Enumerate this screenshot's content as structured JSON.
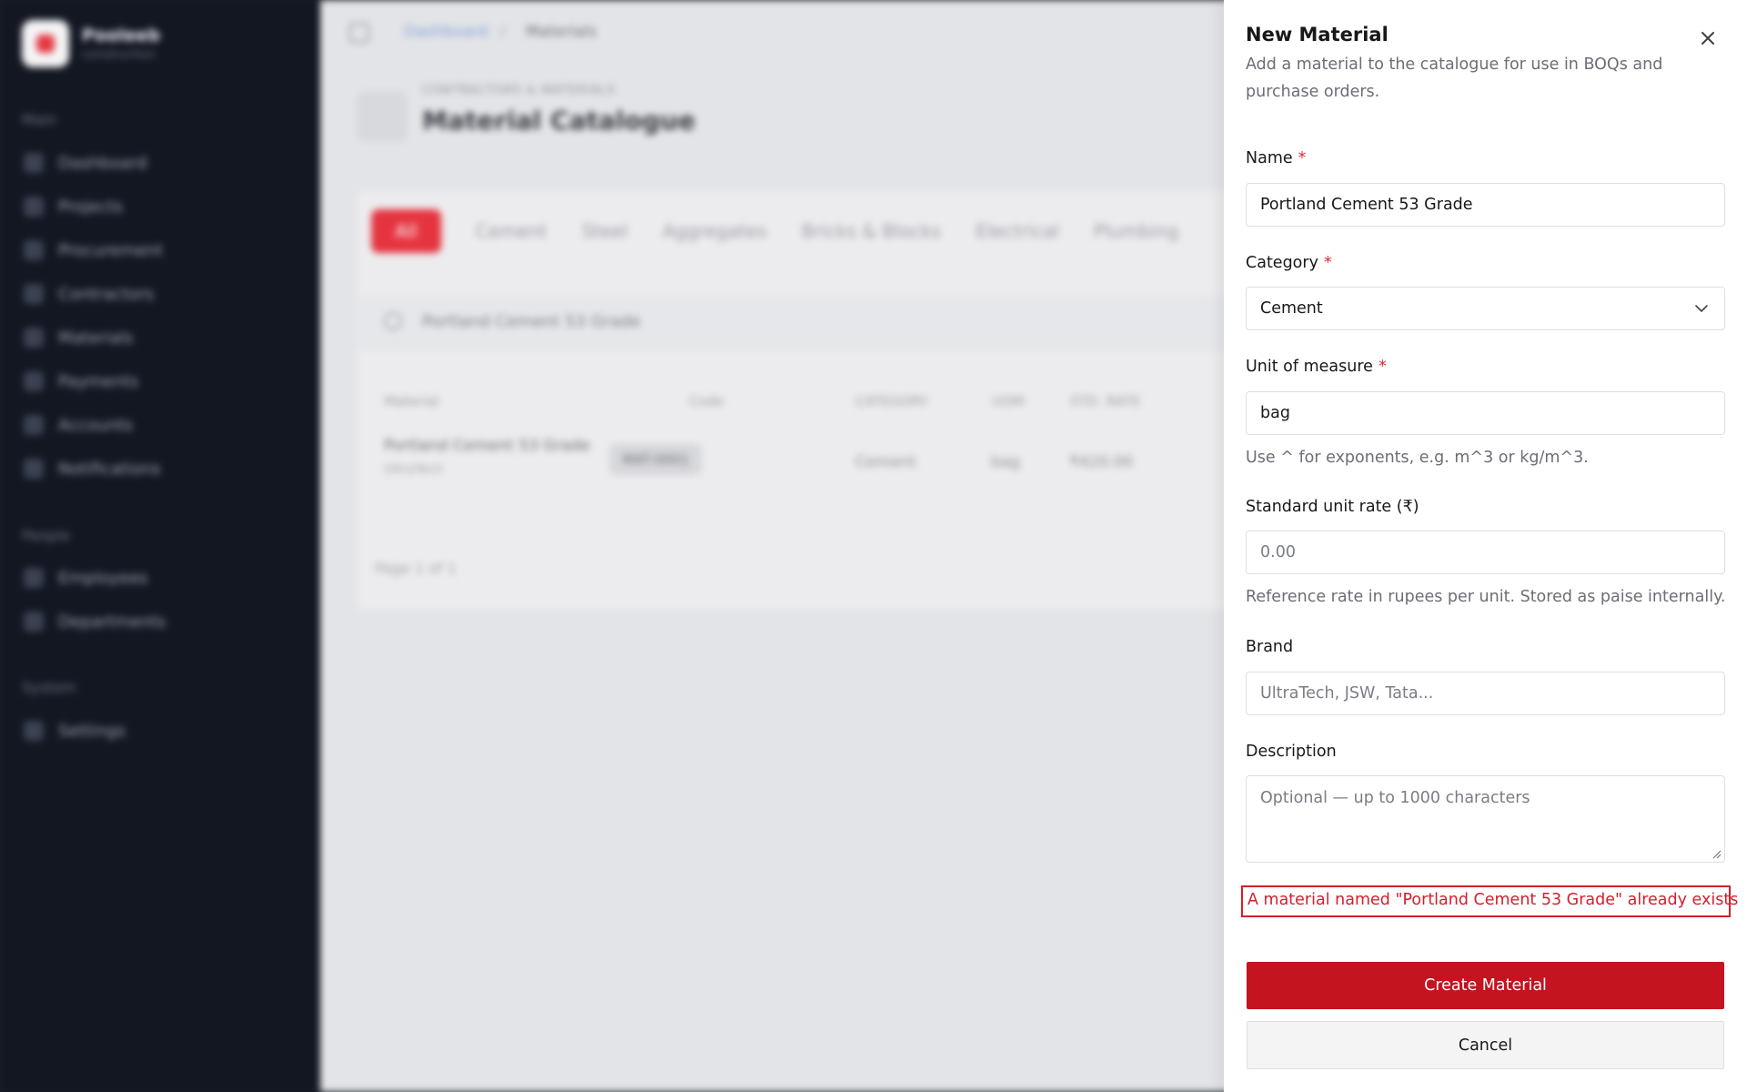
{
  "sidebar": {
    "brand_name": "Pooleeb",
    "brand_subtitle": "construction",
    "groups": [
      {
        "label": "Main",
        "items": [
          "Dashboard",
          "Projects",
          "Procurement",
          "Contractors",
          "Materials",
          "Payments",
          "Accounts",
          "Notifications"
        ]
      },
      {
        "label": "People",
        "items": [
          "Employees",
          "Departments"
        ]
      },
      {
        "label": "System",
        "items": [
          "Settings"
        ]
      }
    ]
  },
  "topbar": {
    "breadcrumb_home": "Dashboard",
    "breadcrumb_separator": "/",
    "breadcrumb_current": "Materials"
  },
  "page": {
    "overline": "CONTRACTORS & MATERIALS",
    "title": "Material Catalogue",
    "tabs": [
      "All",
      "Cement",
      "Steel",
      "Aggregates",
      "Bricks & Blocks",
      "Electrical",
      "Plumbing"
    ],
    "search_value": "Portland Cement 53 Grade",
    "columns": [
      "Material",
      "Code",
      "CATEGORY",
      "UOM",
      "STD. RATE"
    ],
    "row": {
      "name": "Portland Cement 53 Grade",
      "brand": "UltraTech",
      "code": "MAT-0001",
      "category": "Cement",
      "uom": "bag",
      "rate": "₹420.00"
    },
    "pager": "Page 1 of 1"
  },
  "drawer": {
    "title": "New Material",
    "description": "Add a material to the catalogue for use in BOQs and purchase orders.",
    "required_marker": "*",
    "name": {
      "label": "Name",
      "value": "Portland Cement 53 Grade"
    },
    "category": {
      "label": "Category",
      "value": "Cement"
    },
    "uom": {
      "label": "Unit of measure",
      "value": "bag",
      "hint": "Use ^ for exponents, e.g. m^3 or kg/m^3."
    },
    "rate": {
      "label": "Standard unit rate (₹)",
      "placeholder": "0.00",
      "hint": "Reference rate in rupees per unit. Stored as paise internally."
    },
    "brand": {
      "label": "Brand",
      "placeholder": "UltraTech, JSW, Tata..."
    },
    "description_field": {
      "label": "Description",
      "placeholder": "Optional — up to 1000 characters"
    },
    "error": "A material named \"Portland Cement 53 Grade\" already exists",
    "submit_label": "Create Material",
    "cancel_label": "Cancel"
  },
  "colors": {
    "primary": "#c3141f",
    "error": "#d21f2c",
    "sidebar_bg": "#131722"
  },
  "icons": [
    "close-icon",
    "chevron-down-icon",
    "resize-handle-icon",
    "sidebar-toggle-icon",
    "search-icon"
  ]
}
